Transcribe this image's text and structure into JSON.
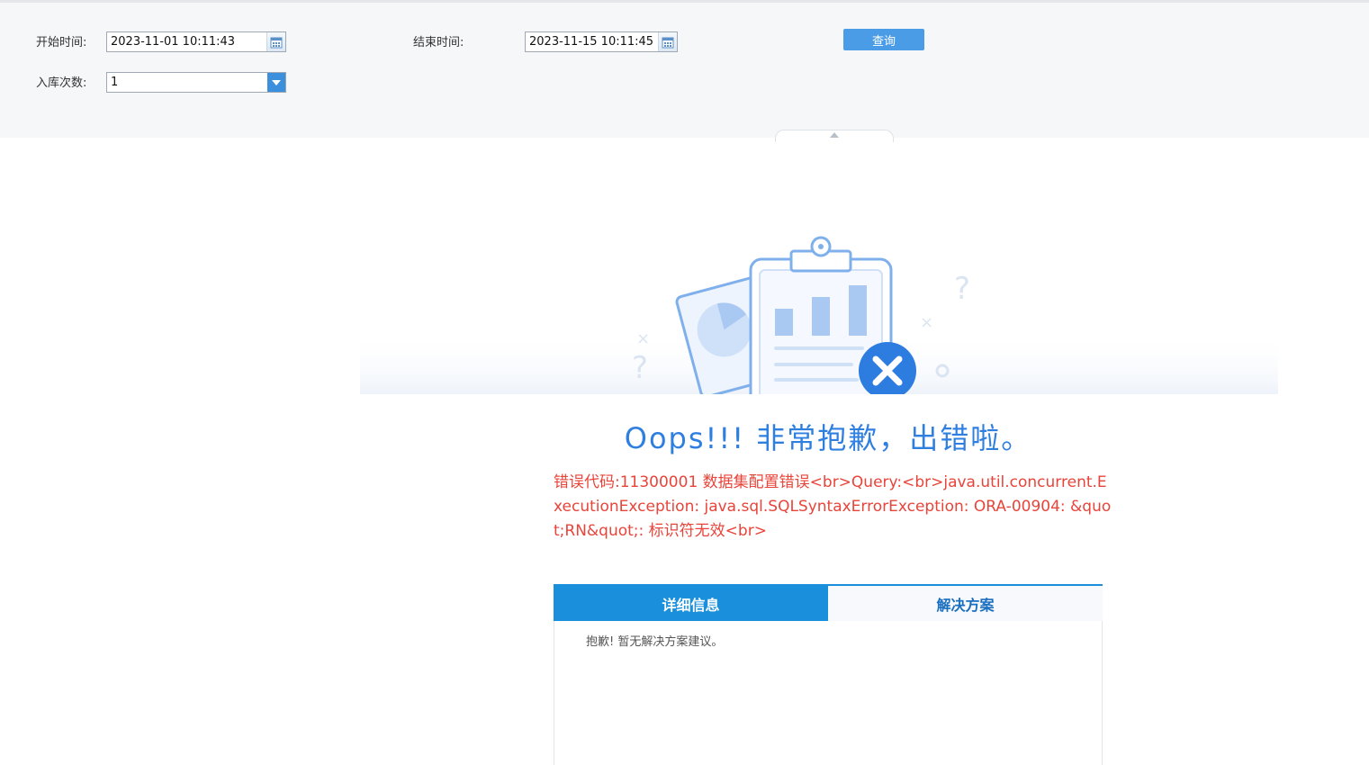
{
  "params": {
    "start_label": "开始时间:",
    "start_value": "2023-11-01 10:11:43",
    "end_label": "结束时间:",
    "end_value": "2023-11-15 10:11:45",
    "count_label": "入库次数:",
    "count_value": "1",
    "query_label": "查询"
  },
  "error": {
    "title": "Oops!!! 非常抱歉，出错啦。",
    "message": "错误代码:11300001 数据集配置错误<br>Query:<br>java.util.concurrent.ExecutionException: java.sql.SQLSyntaxErrorException: ORA-00904: &quot;RN&quot;: 标识符无效<br>",
    "tabs": [
      {
        "label": "详细信息",
        "active": true
      },
      {
        "label": "解决方案",
        "active": false
      }
    ],
    "panel_text": "抱歉! 暂无解决方案建议。"
  },
  "colors": {
    "accent": "#1a8fdb",
    "title": "#2f7fe0",
    "error_text": "#e8443a",
    "param_bg": "#f6f7f9"
  },
  "icons": [
    "calendar-icon",
    "dropdown-arrow-icon",
    "collapse-arrow-icon",
    "clipboard-chart-illustration",
    "error-x-icon"
  ]
}
